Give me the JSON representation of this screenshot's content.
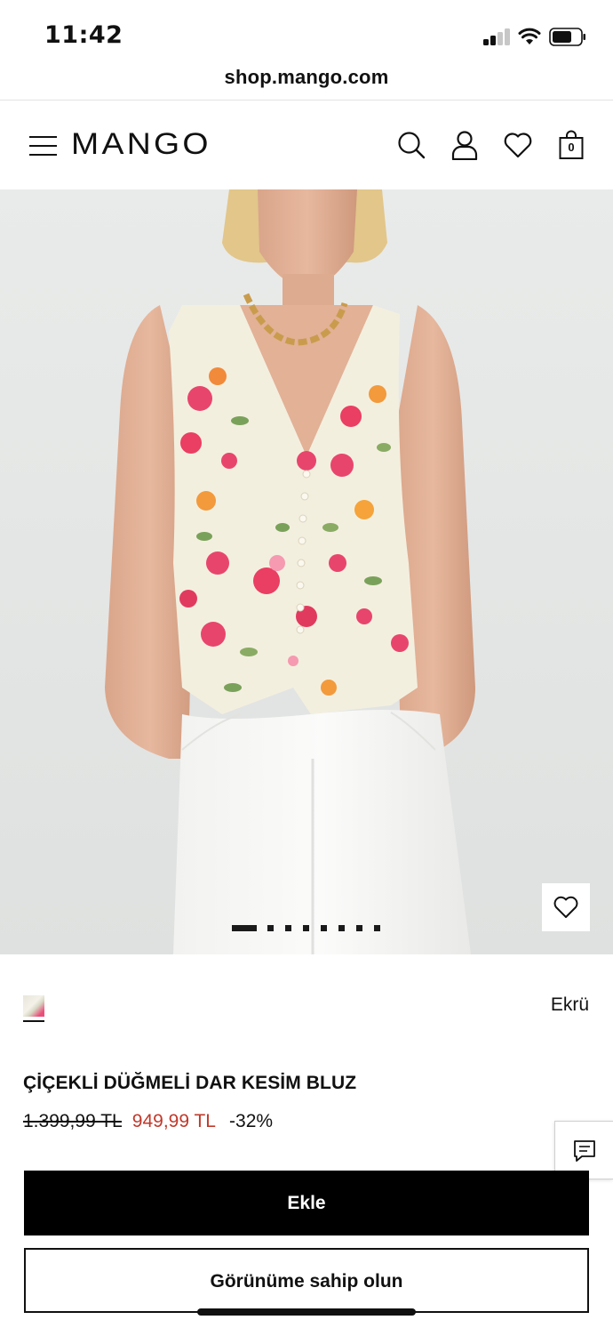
{
  "status_bar": {
    "time": "11:42",
    "signal_icon": "cellular-signal-icon",
    "wifi_icon": "wifi-icon",
    "battery_icon": "battery-icon"
  },
  "browser": {
    "url": "shop.mango.com"
  },
  "header": {
    "logo": "MANGO",
    "menu_icon": "hamburger-menu-icon",
    "search_icon": "search-icon",
    "account_icon": "user-icon",
    "favorites_icon": "heart-icon",
    "bag_icon": "shopping-bag-icon",
    "bag_count": "0"
  },
  "gallery": {
    "image_count": 8,
    "active_index": 0,
    "favorite_icon": "heart-icon"
  },
  "product": {
    "color_name": "Ekrü",
    "title": "ÇİÇEKLİ DÜĞMELİ DAR KESİM BLUZ",
    "price_old": "1.399,99 TL",
    "price_new": "949,99 TL",
    "discount": "-32%"
  },
  "actions": {
    "add_label": "Ekle",
    "look_label": "Görünüme sahip olun",
    "chat_icon": "chat-icon"
  },
  "colors": {
    "brand": "#000000",
    "sale": "#c0392b",
    "background": "#ffffff"
  }
}
